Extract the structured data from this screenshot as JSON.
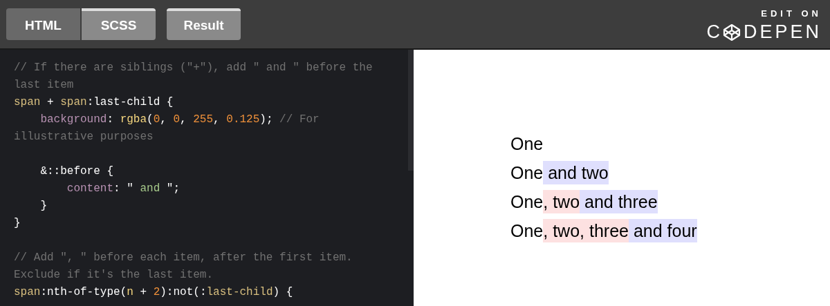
{
  "tabs": [
    {
      "label": "HTML",
      "selected": false
    },
    {
      "label": "SCSS",
      "selected": true
    }
  ],
  "result_tab": {
    "label": "Result",
    "selected": true
  },
  "logo": {
    "caption": "EDIT ON",
    "before": "C",
    "after": "DEPEN"
  },
  "code_lines": [
    {
      "kind": "code",
      "tokens": [
        {
          "kind": "comment",
          "text": "// If there are siblings (\"+\"), add \" and \" before the"
        }
      ]
    },
    {
      "kind": "code",
      "tokens": [
        {
          "kind": "comment",
          "text": "last item"
        }
      ]
    },
    {
      "kind": "code",
      "tokens": [
        {
          "kind": "tag",
          "text": "span"
        },
        {
          "kind": "plain",
          "text": " + "
        },
        {
          "kind": "tag",
          "text": "span"
        },
        {
          "kind": "plain",
          "text": ":last-child {"
        }
      ]
    },
    {
      "kind": "code",
      "tokens": [
        {
          "kind": "property",
          "text": "    background"
        },
        {
          "kind": "plain",
          "text": ": "
        },
        {
          "kind": "func",
          "text": "rgba"
        },
        {
          "kind": "plain",
          "text": "("
        },
        {
          "kind": "number",
          "text": "0"
        },
        {
          "kind": "plain",
          "text": ", "
        },
        {
          "kind": "number",
          "text": "0"
        },
        {
          "kind": "plain",
          "text": ", "
        },
        {
          "kind": "number",
          "text": "255"
        },
        {
          "kind": "plain",
          "text": ", "
        },
        {
          "kind": "number",
          "text": "0.125"
        },
        {
          "kind": "plain",
          "text": "); "
        },
        {
          "kind": "comment",
          "text": "// For"
        }
      ]
    },
    {
      "kind": "code",
      "tokens": [
        {
          "kind": "comment",
          "text": "illustrative purposes"
        }
      ]
    },
    {
      "kind": "blank"
    },
    {
      "kind": "code",
      "tokens": [
        {
          "kind": "plain",
          "text": "    &::before {"
        }
      ]
    },
    {
      "kind": "code",
      "tokens": [
        {
          "kind": "property",
          "text": "        content"
        },
        {
          "kind": "plain",
          "text": ": \""
        },
        {
          "kind": "string",
          "text": " and "
        },
        {
          "kind": "plain",
          "text": "\";"
        }
      ]
    },
    {
      "kind": "code",
      "tokens": [
        {
          "kind": "plain",
          "text": "    }"
        }
      ]
    },
    {
      "kind": "code",
      "tokens": [
        {
          "kind": "plain",
          "text": "}"
        }
      ]
    },
    {
      "kind": "blank"
    },
    {
      "kind": "code",
      "tokens": [
        {
          "kind": "comment",
          "text": "// Add \", \" before each item, after the first item."
        }
      ]
    },
    {
      "kind": "code",
      "tokens": [
        {
          "kind": "comment",
          "text": "Exclude if it's the last item."
        }
      ]
    },
    {
      "kind": "code",
      "tokens": [
        {
          "kind": "tag",
          "text": "span"
        },
        {
          "kind": "plain",
          "text": ":nth-of-type("
        },
        {
          "kind": "func",
          "text": "n"
        },
        {
          "kind": "plain",
          "text": " + "
        },
        {
          "kind": "number",
          "text": "2"
        },
        {
          "kind": "plain",
          "text": "):not(:"
        },
        {
          "kind": "tag",
          "text": "last-child"
        },
        {
          "kind": "plain",
          "text": ") {"
        }
      ]
    }
  ],
  "result_lines": [
    [
      {
        "kind": "plain",
        "text": "One"
      }
    ],
    [
      {
        "kind": "plain",
        "text": "One"
      },
      {
        "kind": "last",
        "text": " and two"
      }
    ],
    [
      {
        "kind": "plain",
        "text": "One"
      },
      {
        "kind": "middle",
        "text": ", two"
      },
      {
        "kind": "last",
        "text": " and three"
      }
    ],
    [
      {
        "kind": "plain",
        "text": "One"
      },
      {
        "kind": "middle",
        "text": ", two, three"
      },
      {
        "kind": "last",
        "text": " and four"
      }
    ]
  ]
}
